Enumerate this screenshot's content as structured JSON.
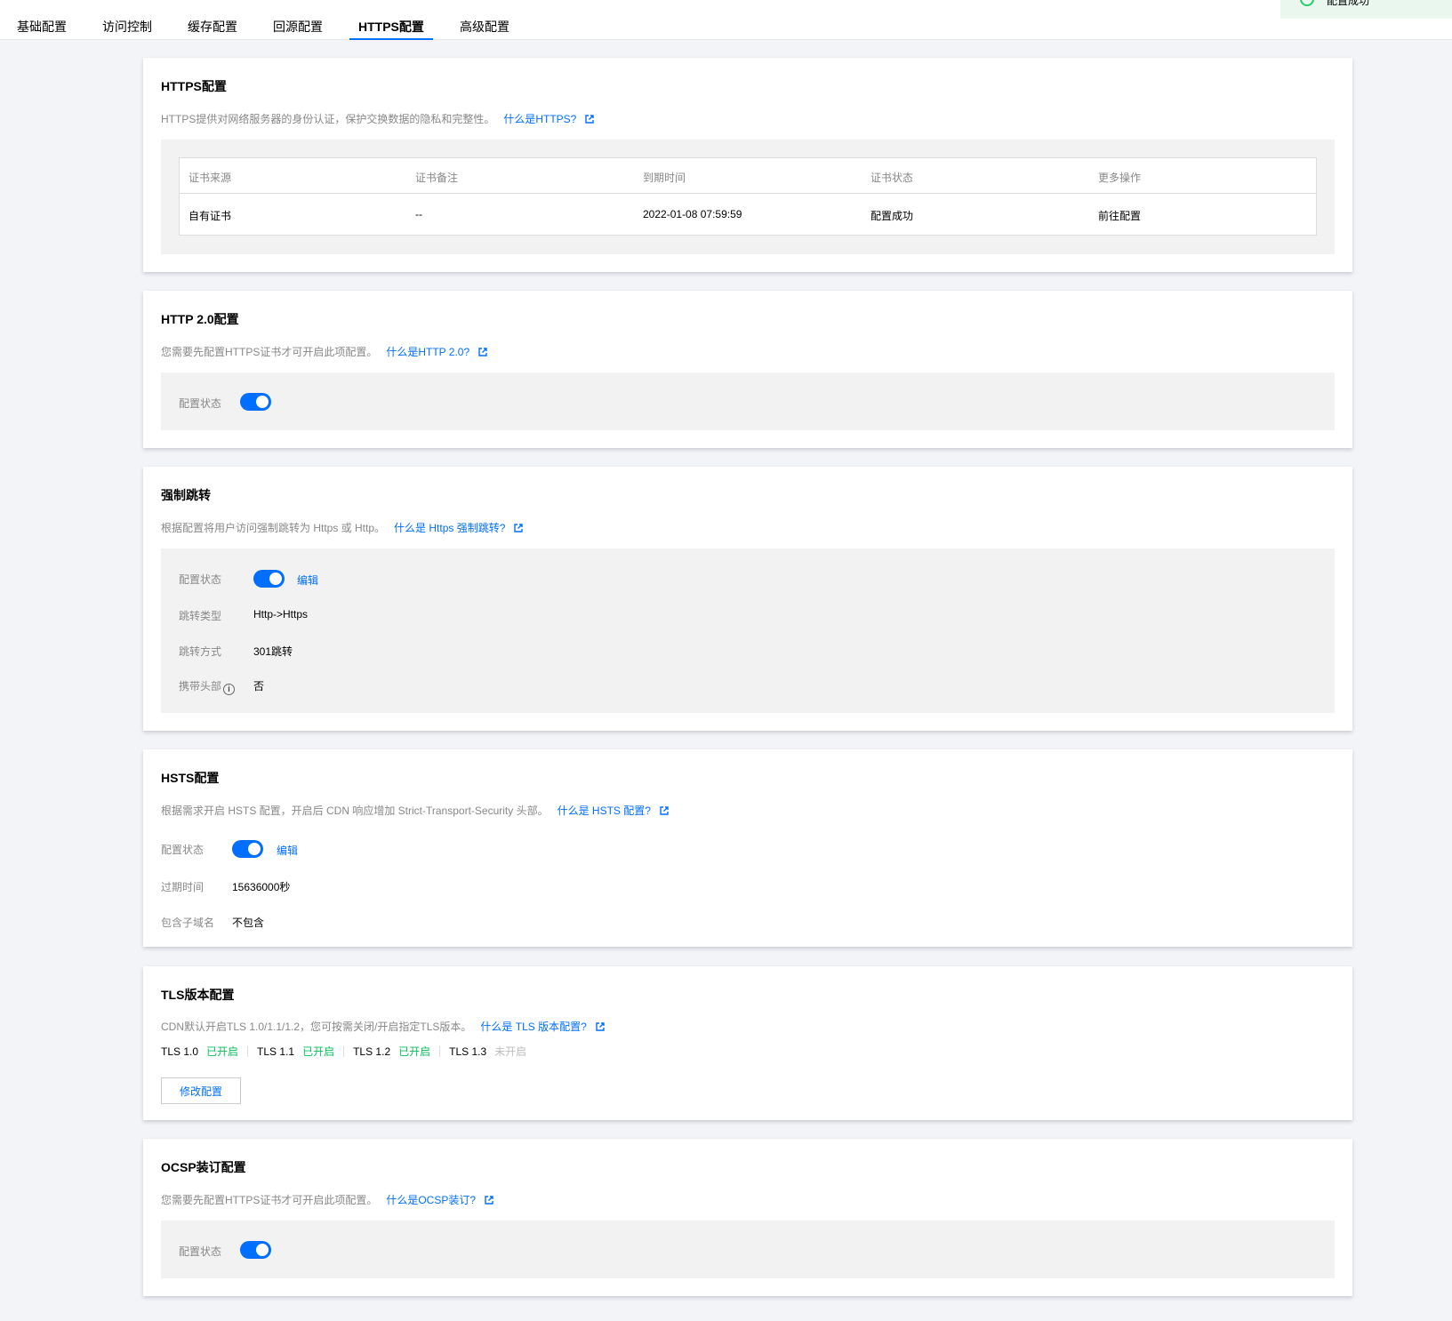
{
  "tabs": [
    {
      "label": "基础配置"
    },
    {
      "label": "访问控制"
    },
    {
      "label": "缓存配置"
    },
    {
      "label": "回源配置"
    },
    {
      "label": "HTTPS配置",
      "active": true
    },
    {
      "label": "高级配置"
    }
  ],
  "toast": {
    "text": "配置成功",
    "icon": "check-circle-icon",
    "color": "#29cc6a"
  },
  "colors": {
    "accent": "#006eff",
    "enabled": "#0abf5b",
    "disabled": "#bbbbbb"
  },
  "https": {
    "title": "HTTPS配置",
    "desc": "HTTPS提供对网络服务器的身份认证，保护交换数据的隐私和完整性。",
    "link": "什么是HTTPS?",
    "table": {
      "headers": [
        "证书来源",
        "证书备注",
        "到期时间",
        "证书状态",
        "更多操作"
      ],
      "row": [
        "自有证书",
        "--",
        "2022-01-08 07:59:59",
        "配置成功",
        "前往配置"
      ]
    }
  },
  "http2": {
    "title": "HTTP 2.0配置",
    "desc": "您需要先配置HTTPS证书才可开启此项配置。",
    "link": "什么是HTTP 2.0?",
    "status_label": "配置状态",
    "enabled": true
  },
  "redirect": {
    "title": "强制跳转",
    "desc": "根据配置将用户访问强制跳转为 Https 或 Http。",
    "link": "什么是 Https 强制跳转?",
    "status_label": "配置状态",
    "enabled": true,
    "edit": "编辑",
    "type_label": "跳转类型",
    "type_value": "Http->Https",
    "method_label": "跳转方式",
    "method_value": "301跳转",
    "header_label": "携带头部",
    "header_value": "否"
  },
  "hsts": {
    "title": "HSTS配置",
    "desc": "根据需求开启 HSTS 配置，开启后 CDN 响应增加 Strict-Transport-Security 头部。",
    "link": "什么是 HSTS 配置?",
    "status_label": "配置状态",
    "enabled": true,
    "edit": "编辑",
    "expire_label": "过期时间",
    "expire_value": "15636000秒",
    "subdomain_label": "包含子域名",
    "subdomain_value": "不包含"
  },
  "tls": {
    "title": "TLS版本配置",
    "desc": "CDN默认开启TLS 1.0/1.1/1.2，您可按需关闭/开启指定TLS版本。",
    "link": "什么是 TLS 版本配置?",
    "versions": [
      {
        "name": "TLS 1.0",
        "status": "已开启"
      },
      {
        "name": "TLS 1.1",
        "status": "已开启"
      },
      {
        "name": "TLS 1.2",
        "status": "已开启"
      },
      {
        "name": "TLS 1.3",
        "status": "未开启"
      }
    ],
    "button": "修改配置"
  },
  "ocsp": {
    "title": "OCSP装订配置",
    "desc": "您需要先配置HTTPS证书才可开启此项配置。",
    "link": "什么是OCSP装订?",
    "status_label": "配置状态",
    "enabled": true
  }
}
